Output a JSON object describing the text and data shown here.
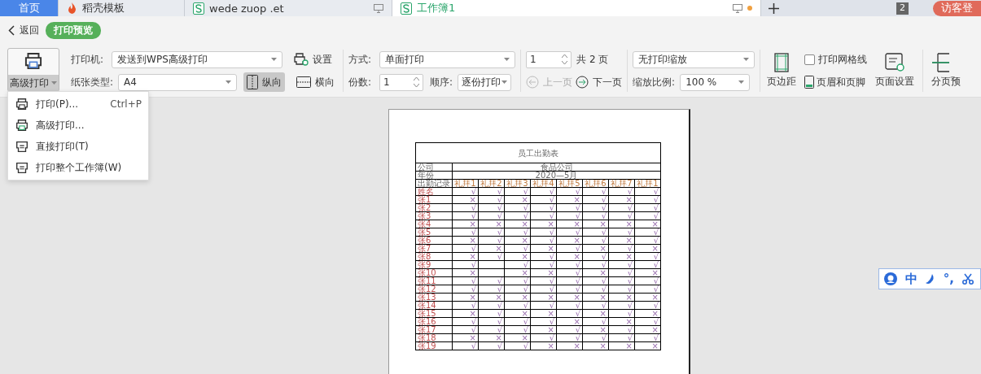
{
  "tabs": [
    {
      "label": "首页",
      "kind": "home",
      "selected": false
    },
    {
      "label": "稻壳模板",
      "kind": "docer",
      "selected": false
    },
    {
      "label": "wede zuop .et",
      "kind": "sheet",
      "selected": false,
      "modified": false
    },
    {
      "label": "工作簿1",
      "kind": "sheet",
      "selected": true,
      "modified": true
    }
  ],
  "tab_count": "2",
  "login_button": "访客登",
  "back_button": "返回",
  "mode_badge": "打印预览",
  "toolbar": {
    "advanced_print": {
      "label": "高级打印",
      "pressed": true
    },
    "printer": {
      "label": "打印机:",
      "value": "发送到WPS高级打印"
    },
    "settings_button": "设置",
    "paper": {
      "label": "纸张类型:",
      "value": "A4"
    },
    "orientation": [
      {
        "label": "纵向",
        "kind": "portrait",
        "selected": true
      },
      {
        "label": "横向",
        "kind": "landscape",
        "selected": false
      }
    ],
    "mode": {
      "label": "方式:",
      "value": "单面打印"
    },
    "copies": {
      "label": "份数:",
      "value": "1"
    },
    "order": {
      "label": "顺序:",
      "value": "逐份打印"
    },
    "page": {
      "value": "1",
      "total": "共 2 页"
    },
    "prev_page": {
      "label": "上一页",
      "disabled": true
    },
    "next_page": {
      "label": "下一页",
      "disabled": false
    },
    "scaling": {
      "value": "无打印缩放"
    },
    "zoom": {
      "label": "缩放比例:",
      "value": "100 %"
    },
    "margins_button": "页边距",
    "gridlines": {
      "label": "打印网格线",
      "checked": false
    },
    "header_footer_button": "页眉和页脚",
    "page_setup_button": "页面设置",
    "page_break_button": "分页预"
  },
  "print_menu": [
    {
      "label": "打印(P)...",
      "shortcut": "Ctrl+P",
      "kind": "print"
    },
    {
      "label": "高级打印...",
      "kind": "advanced"
    },
    {
      "label": "直接打印(T)",
      "kind": "direct"
    },
    {
      "label": "打印整个工作簿(W)",
      "kind": "direct"
    }
  ],
  "sheet": {
    "title": "员工出勤表",
    "info_rows": [
      {
        "label": "公司",
        "value": "食品公司"
      },
      {
        "label": "年份",
        "value": "2020—5月"
      }
    ],
    "header": {
      "label": "出勤记录",
      "days": [
        "礼拜1",
        "礼拜2",
        "礼拜3",
        "礼拜4",
        "礼拜5",
        "礼拜6",
        "礼拜7",
        "礼拜1"
      ]
    },
    "rows": [
      {
        "name": "姓名",
        "marks": [
          "√",
          "√",
          "√",
          "√",
          "√",
          "√",
          "√",
          "√"
        ]
      },
      {
        "name": "张1",
        "marks": [
          "×",
          "√",
          "×",
          "√",
          "×",
          "√",
          "×",
          "√"
        ]
      },
      {
        "name": "张2",
        "marks": [
          "√",
          "√",
          "√",
          "√",
          "√",
          "√",
          "√",
          "√"
        ]
      },
      {
        "name": "张3",
        "marks": [
          "√",
          "√",
          "√",
          "√",
          "√",
          "√",
          "√",
          "√"
        ]
      },
      {
        "name": "张4",
        "marks": [
          "×",
          "×",
          "×",
          "×",
          "×",
          "×",
          "×",
          "×"
        ]
      },
      {
        "name": "张5",
        "marks": [
          "√",
          "√",
          "√",
          "√",
          "√",
          "√",
          "√",
          "√"
        ]
      },
      {
        "name": "张6",
        "marks": [
          "×",
          "√",
          "×",
          "√",
          "×",
          "√",
          "×",
          "√"
        ]
      },
      {
        "name": "张7",
        "marks": [
          "√",
          "×",
          "√",
          "×",
          "√",
          "×",
          "√",
          "×"
        ]
      },
      {
        "name": "张8",
        "marks": [
          "×",
          "√",
          "×",
          "√",
          "×",
          "√",
          "×",
          "√"
        ]
      },
      {
        "name": "张9",
        "marks": [
          "√",
          {
            "kind": "blank"
          },
          "√",
          "√",
          "√",
          "√",
          "√",
          "√"
        ]
      },
      {
        "name": "张10",
        "marks": [
          "×",
          {
            "kind": "blank"
          },
          "×",
          "×",
          "√",
          "×",
          "√",
          "×"
        ]
      },
      {
        "name": "张11",
        "marks": [
          "√",
          "√",
          "√",
          "√",
          "√",
          "√",
          "√",
          "√"
        ]
      },
      {
        "name": "张12",
        "marks": [
          "√",
          "√",
          "√",
          "√",
          "√",
          "√",
          "√",
          "√"
        ]
      },
      {
        "name": "张13",
        "marks": [
          "×",
          "×",
          "×",
          "×",
          "×",
          "×",
          "×",
          "×"
        ]
      },
      {
        "name": "张14",
        "marks": [
          "√",
          "√",
          "√",
          "√",
          "√",
          "√",
          "√",
          "√"
        ]
      },
      {
        "name": "张15",
        "marks": [
          "×",
          "√",
          "×",
          "×",
          "√",
          "×",
          "√",
          "×"
        ]
      },
      {
        "name": "张16",
        "marks": [
          "√",
          "√",
          "√",
          "√",
          "×",
          "√",
          "×",
          "√"
        ]
      },
      {
        "name": "张17",
        "marks": [
          "√",
          "√",
          "√",
          "×",
          "√",
          "×",
          "√",
          "×"
        ]
      },
      {
        "name": "张18",
        "marks": [
          "×",
          "×",
          "×",
          "√",
          "√",
          "√",
          "√",
          "√"
        ]
      },
      {
        "name": "张19",
        "marks": [
          "√",
          "√",
          "√",
          "×",
          "×",
          "×",
          "×",
          "×"
        ]
      }
    ]
  },
  "ime_bar": {
    "mode": "中",
    "punctuation": "°,"
  }
}
